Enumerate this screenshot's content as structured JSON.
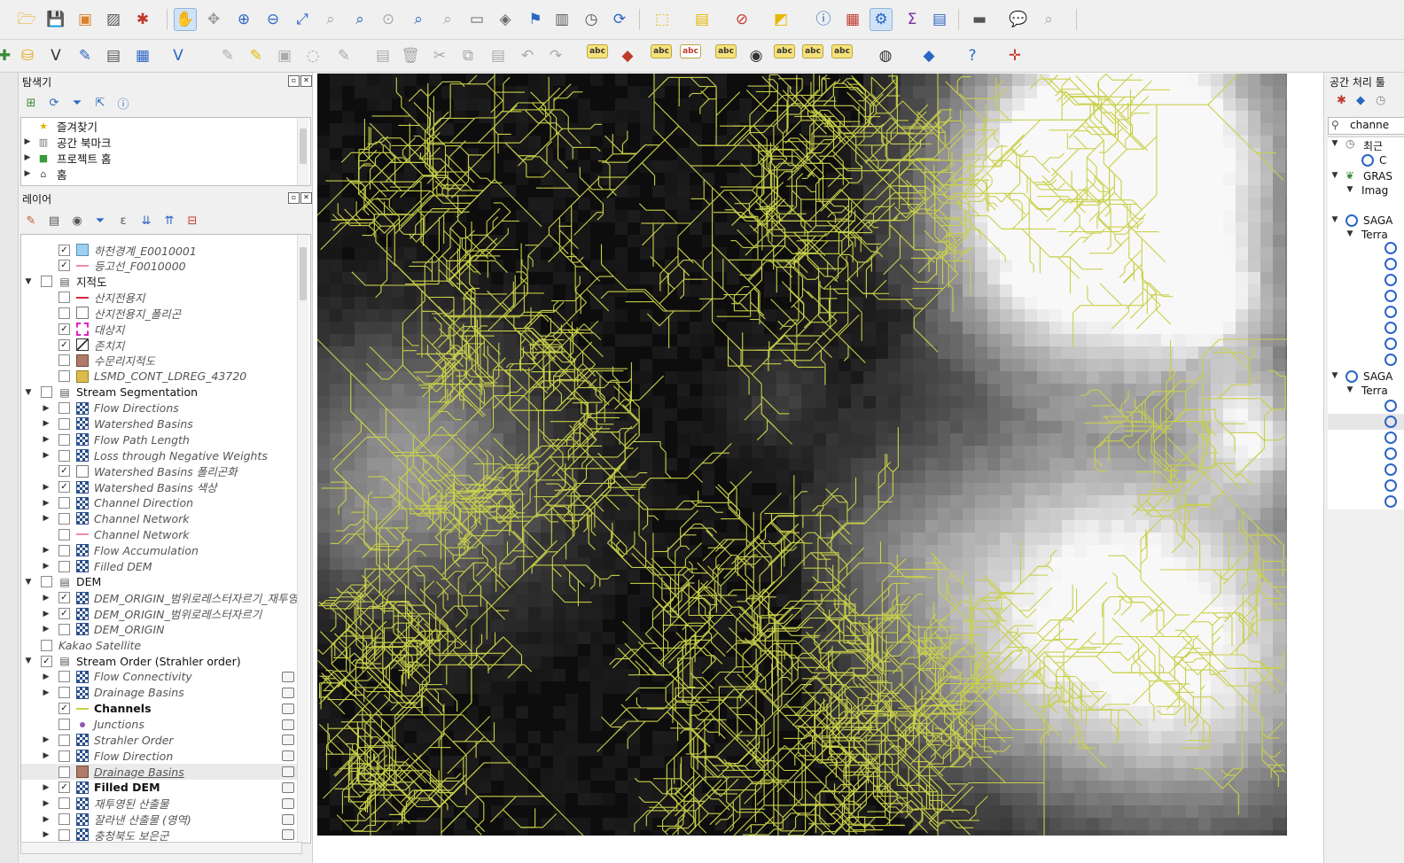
{
  "toolbar_top": {
    "icons": [
      "open-folder-icon",
      "save-icon",
      "save-as-icon",
      "print-layout-icon",
      "style-manager-icon",
      "pan-hand-icon",
      "pan-selection-icon",
      "zoom-in-icon",
      "zoom-out-icon",
      "zoom-full-icon",
      "zoom-selection-icon",
      "zoom-layer-icon",
      "zoom-native-icon",
      "zoom-last-icon",
      "zoom-next-icon",
      "new-map-view-icon",
      "new-3d-view-icon",
      "new-bookmark-icon",
      "show-bookmarks-icon",
      "temporal-controller-icon",
      "refresh-icon",
      "select-features-icon",
      "select-value-icon",
      "deselect-icon",
      "select-location-icon",
      "identify-icon",
      "attribute-table-icon",
      "processing-toolbox-icon",
      "statistics-sigma-icon",
      "open-field-calculator-icon",
      "measure-icon",
      "map-tips-icon",
      "locator-icon"
    ]
  },
  "toolbar_second": {
    "labels": [
      "abc",
      "abc",
      "abc",
      "abc",
      "abc",
      "abc",
      "abc"
    ]
  },
  "browser_panel": {
    "title": "탐색기",
    "items": [
      {
        "label": "즐겨찾기"
      },
      {
        "label": "공간 북마크"
      },
      {
        "label": "프로젝트 홈"
      },
      {
        "label": "홈"
      }
    ]
  },
  "layers_panel": {
    "title": "레이어",
    "rows": [
      {
        "label": "하천경계_E0010001",
        "checked": true,
        "level": 2,
        "style": "italic",
        "sym": "fill-blue"
      },
      {
        "label": "등고선_F0010000",
        "checked": true,
        "level": 2,
        "style": "italic",
        "sym": "line-pink"
      },
      {
        "label": "지적도",
        "checked": false,
        "level": 1,
        "style": "plain",
        "sym": "group",
        "expanded": true
      },
      {
        "label": "산지전용지",
        "checked": false,
        "level": 2,
        "style": "italic",
        "sym": "line-red"
      },
      {
        "label": "산지전용지_폴리곤",
        "checked": false,
        "level": 2,
        "style": "italic",
        "sym": "fill-white"
      },
      {
        "label": "대상지",
        "checked": true,
        "level": 2,
        "style": "italic",
        "sym": "fill-dash-magenta"
      },
      {
        "label": "존치지",
        "checked": true,
        "level": 2,
        "style": "italic",
        "sym": "fill-hatch"
      },
      {
        "label": "수문리지적도",
        "checked": false,
        "level": 2,
        "style": "italic",
        "sym": "fill-brown"
      },
      {
        "label": "LSMD_CONT_LDREG_43720",
        "checked": false,
        "level": 2,
        "style": "italic",
        "sym": "fill-gold"
      },
      {
        "label": "Stream Segmentation",
        "checked": false,
        "level": 1,
        "style": "plain",
        "sym": "group",
        "expanded": true
      },
      {
        "label": "Flow Directions",
        "checked": false,
        "level": 2,
        "style": "italic",
        "sym": "raster",
        "arrow": true
      },
      {
        "label": "Watershed Basins",
        "checked": false,
        "level": 2,
        "style": "italic",
        "sym": "raster",
        "arrow": true
      },
      {
        "label": "Flow Path Length",
        "checked": false,
        "level": 2,
        "style": "italic",
        "sym": "raster",
        "arrow": true
      },
      {
        "label": "Loss through Negative Weights",
        "checked": false,
        "level": 2,
        "style": "italic",
        "sym": "raster",
        "arrow": true
      },
      {
        "label": "Watershed Basins 폴리곤화",
        "checked": true,
        "level": 2,
        "style": "italic",
        "sym": "fill-white"
      },
      {
        "label": "Watershed Basins 색상",
        "checked": true,
        "level": 2,
        "style": "italic",
        "sym": "raster",
        "arrow": true
      },
      {
        "label": "Channel Direction",
        "checked": false,
        "level": 2,
        "style": "italic",
        "sym": "raster",
        "arrow": true
      },
      {
        "label": "Channel Network",
        "checked": false,
        "level": 2,
        "style": "italic",
        "sym": "raster",
        "arrow": true
      },
      {
        "label": "Channel Network",
        "checked": false,
        "level": 2,
        "style": "italic",
        "sym": "line-pink"
      },
      {
        "label": "Flow Accumulation",
        "checked": false,
        "level": 2,
        "style": "italic",
        "sym": "raster",
        "arrow": true
      },
      {
        "label": "Filled DEM",
        "checked": false,
        "level": 2,
        "style": "italic",
        "sym": "raster",
        "arrow": true
      },
      {
        "label": "DEM",
        "checked": false,
        "level": 1,
        "style": "plain",
        "sym": "group",
        "expanded": true
      },
      {
        "label": "DEM_ORIGIN_범위로레스터자르기_재투영",
        "checked": true,
        "level": 2,
        "style": "italic",
        "sym": "raster",
        "arrow": true
      },
      {
        "label": "DEM_ORIGIN_범위로레스터자르기",
        "checked": true,
        "level": 2,
        "style": "italic",
        "sym": "raster",
        "arrow": true
      },
      {
        "label": "DEM_ORIGIN",
        "checked": false,
        "level": 2,
        "style": "italic",
        "sym": "raster",
        "arrow": true
      },
      {
        "label": "Kakao Satellite",
        "checked": false,
        "level": 0,
        "style": "italic",
        "sym": "none"
      },
      {
        "label": "Stream Order (Strahler order)",
        "checked": true,
        "level": 1,
        "style": "plain",
        "sym": "group",
        "expanded": true
      },
      {
        "label": "Flow Connectivity",
        "checked": false,
        "level": 2,
        "style": "italic",
        "sym": "raster",
        "arrow": true,
        "endic": true
      },
      {
        "label": "Drainage Basins",
        "checked": false,
        "level": 2,
        "style": "italic",
        "sym": "raster",
        "arrow": true,
        "endic": true
      },
      {
        "label": "Channels",
        "checked": true,
        "level": 2,
        "style": "bold",
        "sym": "line-olive",
        "endic": true
      },
      {
        "label": "Junctions",
        "checked": false,
        "level": 2,
        "style": "italic",
        "sym": "point-purple",
        "endic": true
      },
      {
        "label": "Strahler Order",
        "checked": false,
        "level": 2,
        "style": "italic",
        "sym": "raster",
        "arrow": true,
        "endic": true
      },
      {
        "label": "Flow Direction",
        "checked": false,
        "level": 2,
        "style": "italic",
        "sym": "raster",
        "arrow": true,
        "endic": true
      },
      {
        "label": "Drainage Basins",
        "checked": false,
        "level": 2,
        "style": "italic-ul",
        "sym": "fill-brown",
        "endic": true
      },
      {
        "label": "Filled DEM",
        "checked": true,
        "level": 2,
        "style": "bold",
        "sym": "raster",
        "arrow": true,
        "endic": true
      },
      {
        "label": "재투영된 산출물",
        "checked": false,
        "level": 2,
        "style": "italic",
        "sym": "raster",
        "arrow": true,
        "endic": true
      },
      {
        "label": "잘라낸 산출물 (영역)",
        "checked": false,
        "level": 2,
        "style": "italic",
        "sym": "raster",
        "arrow": true,
        "endic": true
      },
      {
        "label": "충청북도 보은군",
        "checked": false,
        "level": 2,
        "style": "italic",
        "sym": "raster",
        "arrow": true,
        "endic": true
      }
    ]
  },
  "processing_panel": {
    "title": "공간 처리 툴",
    "search_value": "channe",
    "rows": [
      {
        "label": "최근",
        "indent": 0,
        "icon": "clock"
      },
      {
        "label": "C",
        "indent": 1,
        "icon": "gdal"
      },
      {
        "label": "GRAS",
        "indent": 0,
        "icon": "grass"
      },
      {
        "label": "Imag",
        "indent": 1,
        "icon": "none"
      },
      {
        "label": "SAGA",
        "indent": 0,
        "icon": "saga"
      },
      {
        "label": "Terra",
        "indent": 1,
        "icon": "none"
      },
      {
        "label": "SAGA",
        "indent": 0,
        "icon": "saga"
      },
      {
        "label": "Terra",
        "indent": 1,
        "icon": "none"
      }
    ]
  },
  "map": {
    "channel_color": "#c9d04a"
  }
}
